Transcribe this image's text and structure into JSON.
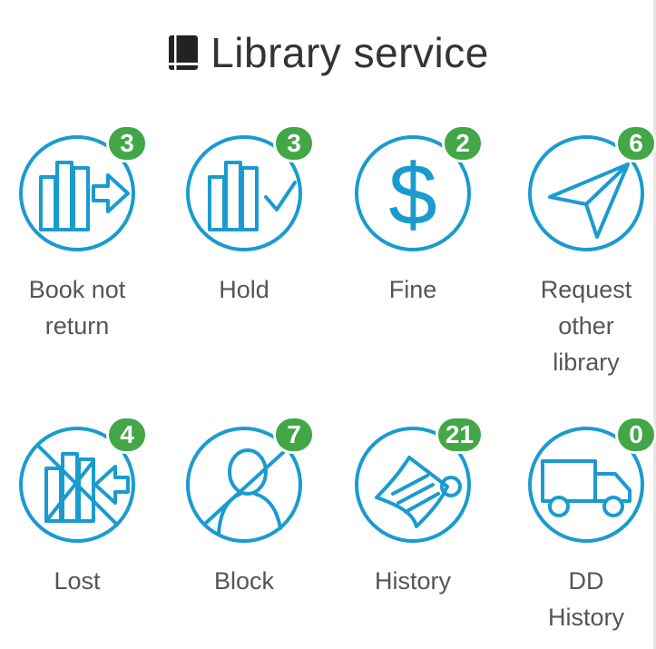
{
  "header": {
    "title": "Library service",
    "icon": "book-icon"
  },
  "accent_color": "#1a9bd0",
  "badge_color": "#43a647",
  "tiles": [
    {
      "label": "Book not\nreturn",
      "count": "3",
      "icon": "book-return-icon"
    },
    {
      "label": "Hold",
      "count": "3",
      "icon": "book-hold-icon"
    },
    {
      "label": "Fine",
      "count": "2",
      "icon": "dollar-icon"
    },
    {
      "label": "Request\nother\nlibrary",
      "count": "6",
      "icon": "paper-plane-icon"
    },
    {
      "label": "Lost",
      "count": "4",
      "icon": "book-lost-icon"
    },
    {
      "label": "Block",
      "count": "7",
      "icon": "person-blocked-icon"
    },
    {
      "label": "History",
      "count": "21",
      "icon": "scroll-icon"
    },
    {
      "label": "DD\nHistory",
      "count": "0",
      "icon": "truck-icon"
    }
  ]
}
